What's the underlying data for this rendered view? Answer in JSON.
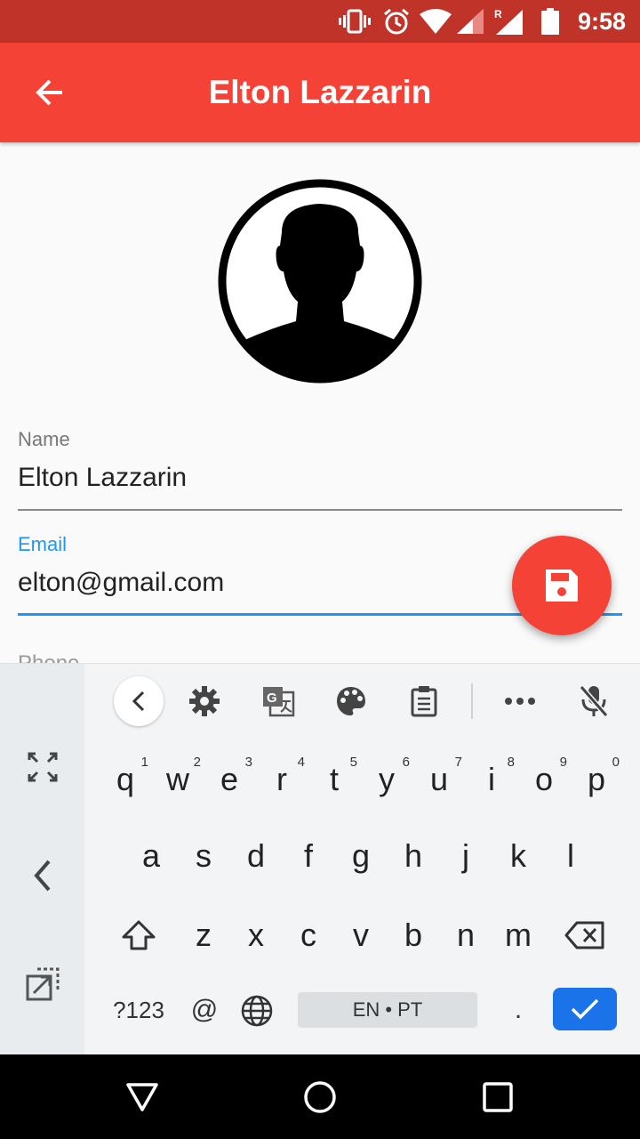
{
  "status_bar": {
    "time": "9:58",
    "icons": [
      "vibrate-icon",
      "alarm-icon",
      "wifi-icon",
      "signal-icon",
      "signal-roaming-icon",
      "battery-icon"
    ]
  },
  "app_bar": {
    "title": "Elton Lazzarin",
    "back_icon": "arrow-back-icon"
  },
  "contact": {
    "avatar_icon": "person-silhouette-icon",
    "fields": [
      {
        "label": "Name",
        "value": "Elton Lazzarin",
        "focused": false
      },
      {
        "label": "Email",
        "value": "elton@gmail.com",
        "focused": true
      }
    ],
    "partial_field_label": "Phone"
  },
  "fab": {
    "icon": "save-icon"
  },
  "keyboard": {
    "toolbar_icons": [
      "chevron-left-icon",
      "gear-icon",
      "translate-icon",
      "palette-icon",
      "clipboard-icon",
      "more-icon",
      "mic-off-icon"
    ],
    "side_icons": [
      "expand-icon",
      "chevron-left-icon",
      "float-icon"
    ],
    "row1": [
      {
        "key": "q",
        "hint": "1"
      },
      {
        "key": "w",
        "hint": "2"
      },
      {
        "key": "e",
        "hint": "3"
      },
      {
        "key": "r",
        "hint": "4"
      },
      {
        "key": "t",
        "hint": "5"
      },
      {
        "key": "y",
        "hint": "6"
      },
      {
        "key": "u",
        "hint": "7"
      },
      {
        "key": "i",
        "hint": "8"
      },
      {
        "key": "o",
        "hint": "9"
      },
      {
        "key": "p",
        "hint": "0"
      }
    ],
    "row2": [
      "a",
      "s",
      "d",
      "f",
      "g",
      "h",
      "j",
      "k",
      "l"
    ],
    "row3": [
      "z",
      "x",
      "c",
      "v",
      "b",
      "n",
      "m"
    ],
    "symbols_label": "?123",
    "at_label": "@",
    "space_label": "EN • PT",
    "period_label": "."
  },
  "nav_bar": {
    "icons": [
      "back-triangle-icon",
      "home-circle-icon",
      "recents-square-icon"
    ]
  }
}
